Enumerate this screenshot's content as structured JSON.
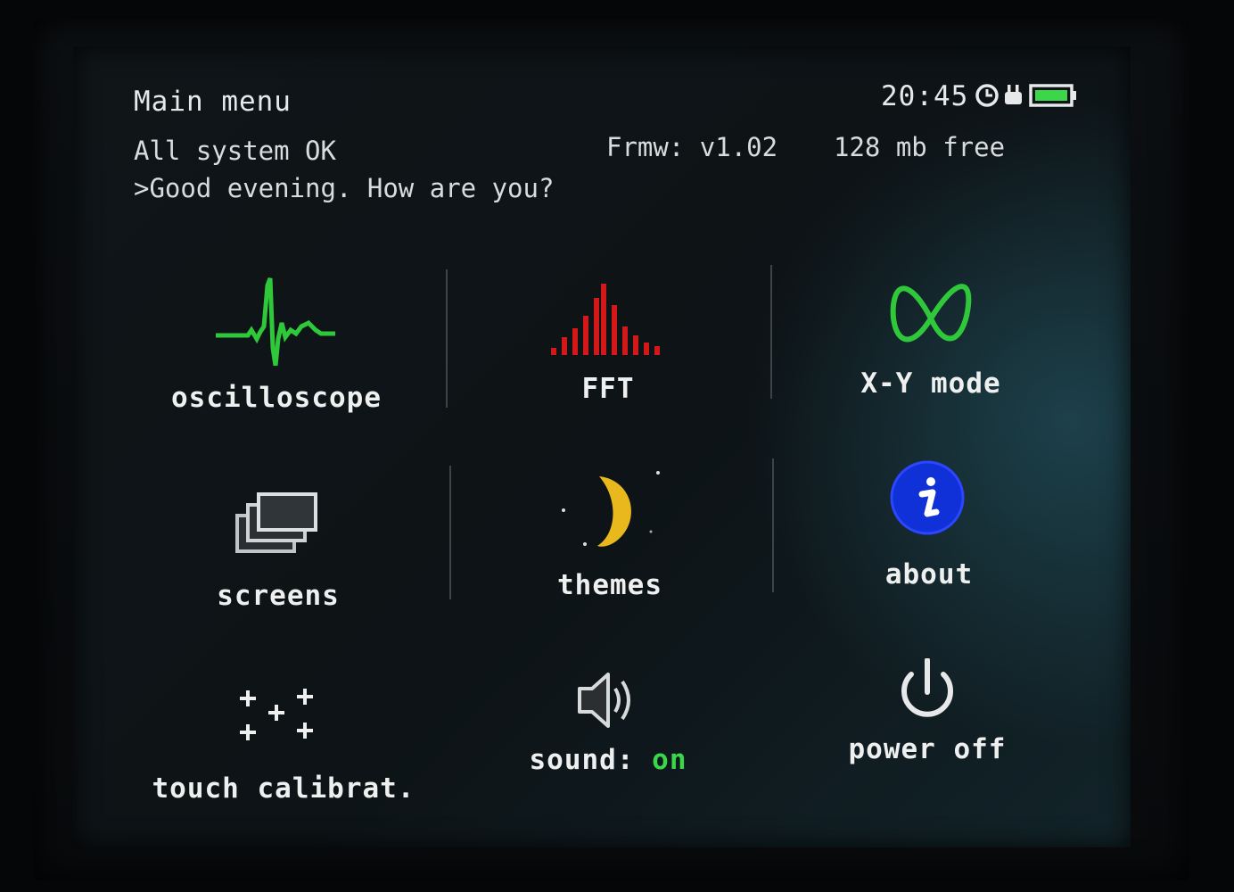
{
  "header": {
    "title": "Main menu",
    "time": "20:45",
    "status_line": "All system OK",
    "greeting": ">Good evening. How are you?",
    "firmware": "Frmw: v1.02",
    "memory": "128 mb free"
  },
  "status_icons": [
    "alarm-icon",
    "plug-icon",
    "battery-icon"
  ],
  "menu": {
    "oscilloscope": {
      "label": "oscilloscope",
      "icon": "waveform-icon",
      "color": "#2ec83a"
    },
    "fft": {
      "label": "FFT",
      "icon": "spectrum-bars-icon",
      "color": "#d21818"
    },
    "xy_mode": {
      "label": "X-Y mode",
      "icon": "lissajous-icon",
      "color": "#2ec83a"
    },
    "screens": {
      "label": "screens",
      "icon": "stacked-screens-icon"
    },
    "themes": {
      "label": "themes",
      "icon": "moon-icon",
      "color": "#e8b81c"
    },
    "about": {
      "label": "about",
      "icon": "info-icon",
      "color": "#1030d8"
    },
    "touch_calibrat": {
      "label": "touch calibrat.",
      "icon": "crosshairs-icon"
    },
    "sound": {
      "label": "sound: ",
      "state": "on",
      "icon": "speaker-icon",
      "state_color": "#3bd64a"
    },
    "power_off": {
      "label": "power off",
      "icon": "power-icon"
    }
  },
  "colors": {
    "screen_bg": "#0e1417",
    "text": "#e6e8e9",
    "battery": "#3bd64a"
  }
}
